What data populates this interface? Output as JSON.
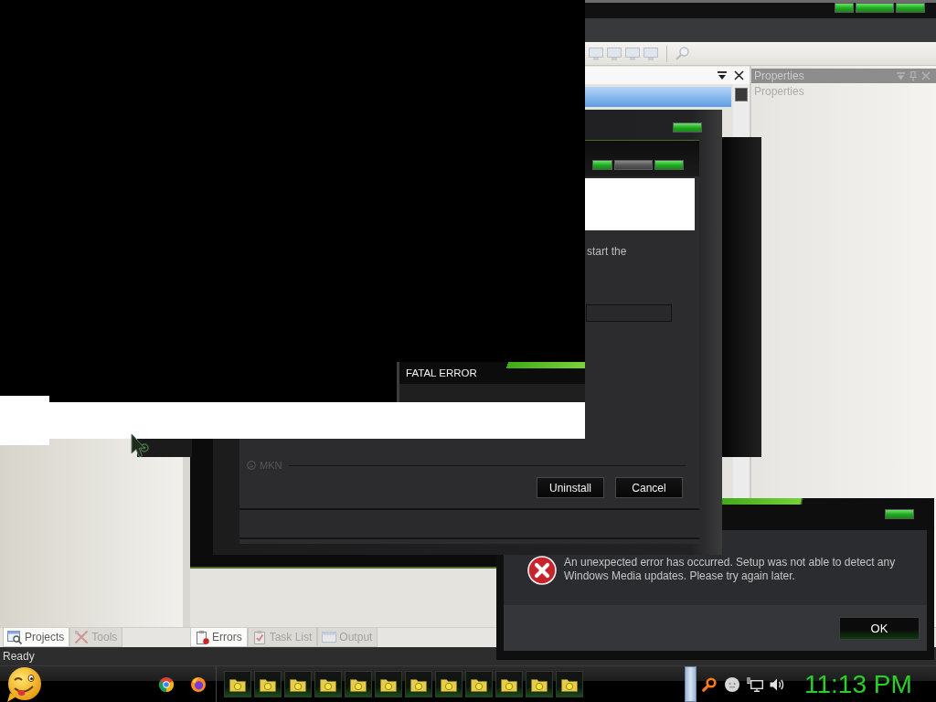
{
  "ide": {
    "properties_panel": {
      "title": "Properties",
      "body_text": "Properties"
    },
    "left_tabs": [
      {
        "label": "Projects",
        "selected": true
      },
      {
        "label": "Tools",
        "selected": false
      }
    ],
    "bottom_tabs": [
      {
        "label": "Errors",
        "selected": true
      },
      {
        "label": "Task List",
        "selected": false
      },
      {
        "label": "Output",
        "selected": false
      }
    ],
    "status_text": "Ready"
  },
  "installer_window": {
    "text": "start the",
    "section_label": "MKN",
    "buttons": [
      "Uninstall",
      "Cancel"
    ]
  },
  "fatal_error_dialog": {
    "title": "FATAL ERROR"
  },
  "error_dialog": {
    "message": "An unexpected error has occurred. Setup was not able to detect any Windows Media updates. Please try again later.",
    "button": "OK"
  },
  "taskbar": {
    "clock": "11:13 PM"
  }
}
